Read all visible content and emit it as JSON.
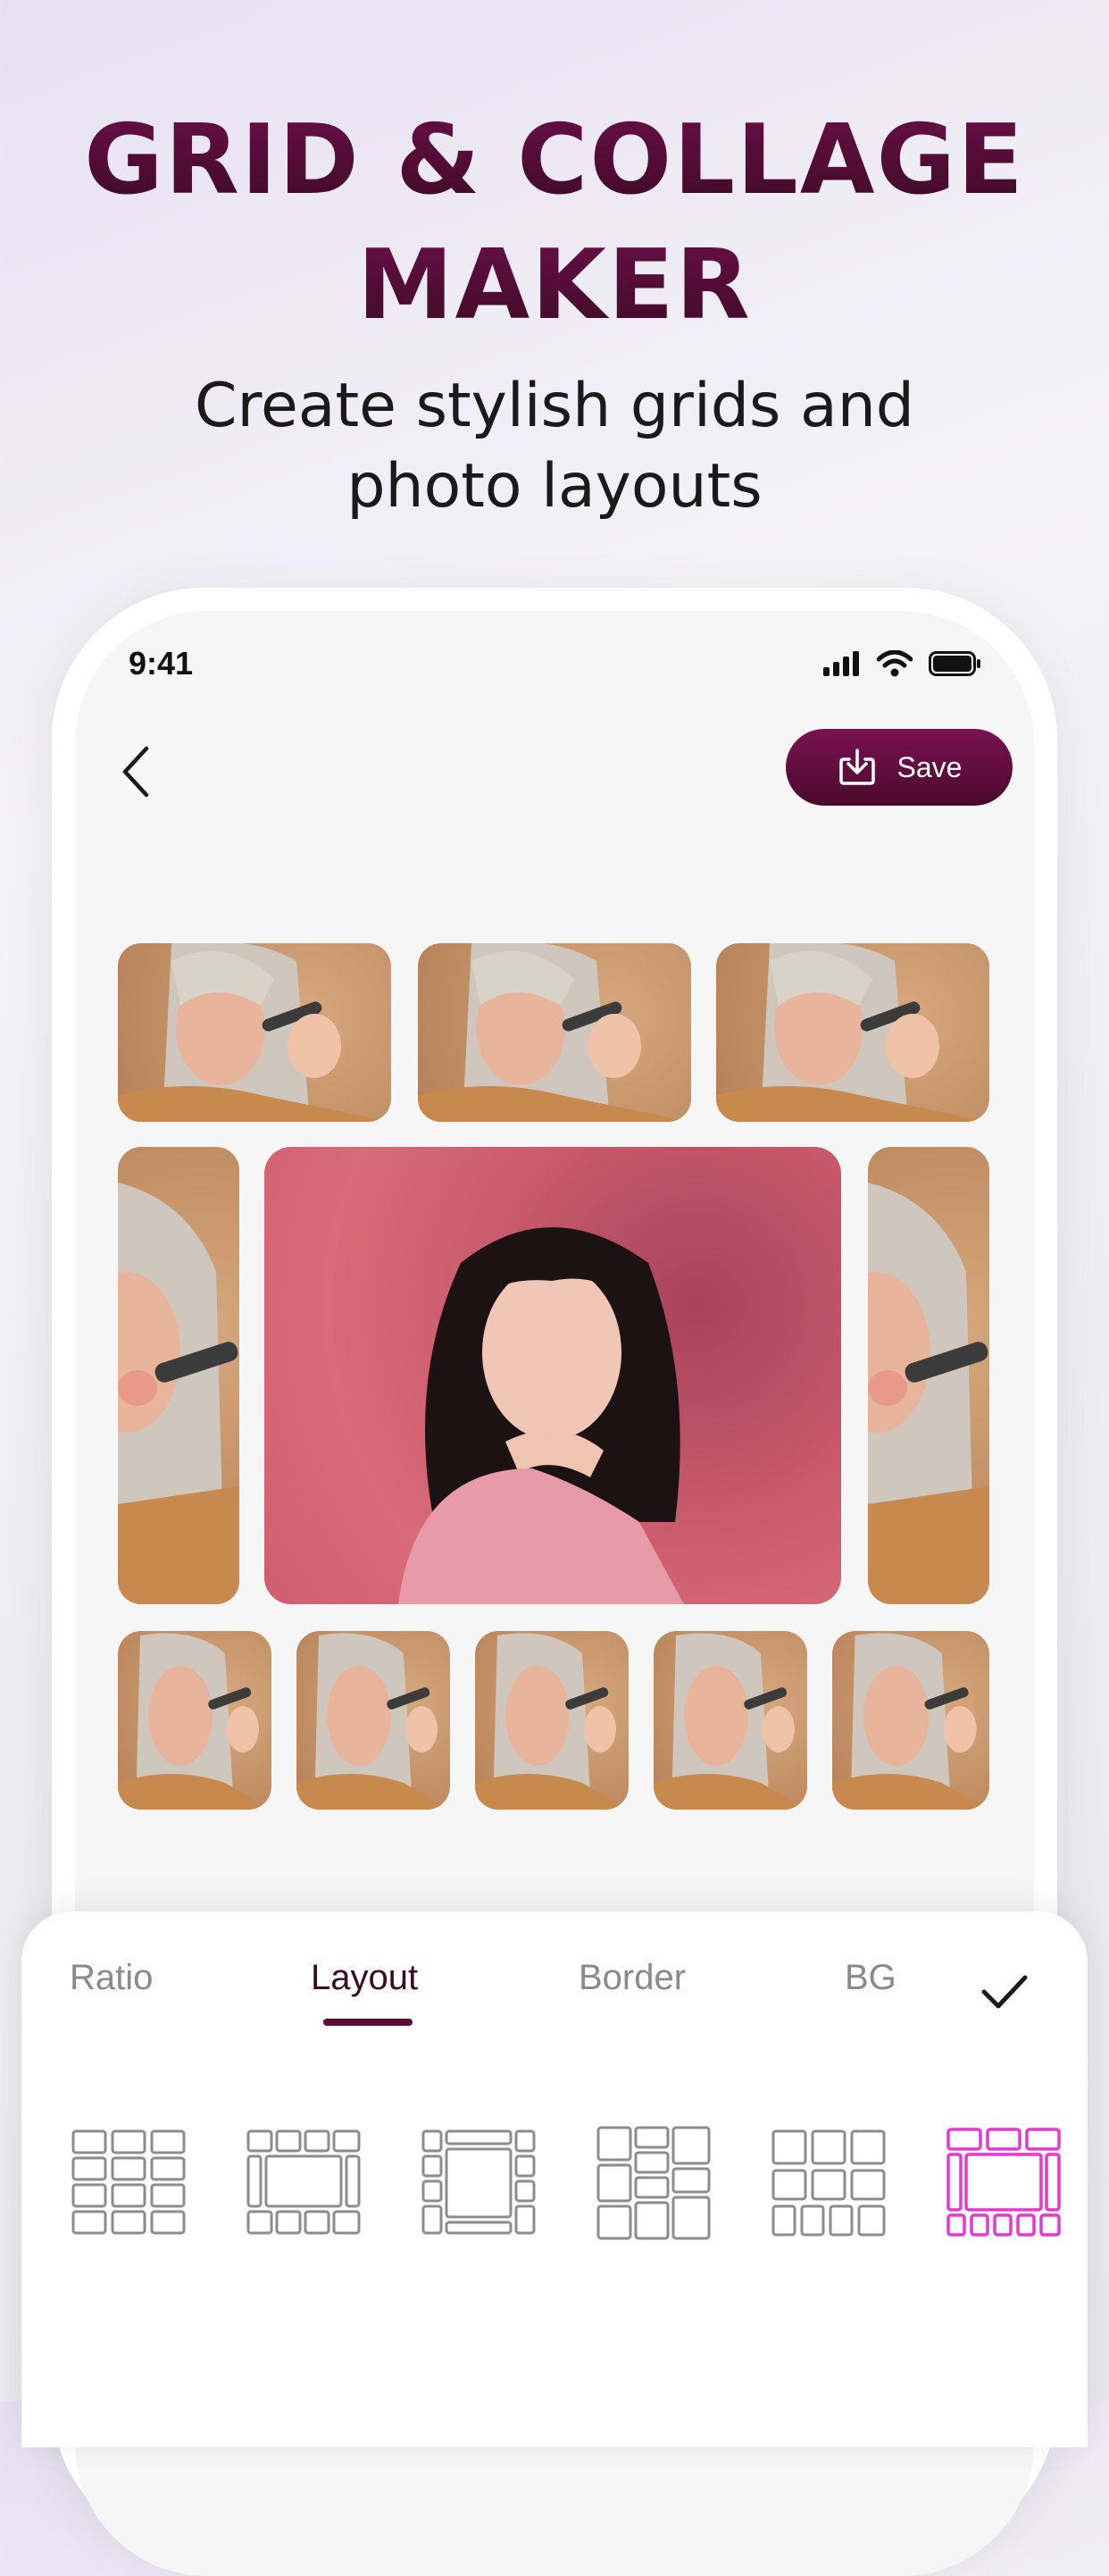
{
  "headline": {
    "line1": "GRID & COLLAGE",
    "line2": "MAKER"
  },
  "subtitle": {
    "line1": "Create stylish grids and",
    "line2": "photo layouts"
  },
  "status_bar": {
    "time": "9:41"
  },
  "toolbar": {
    "save_label": "Save"
  },
  "tabs": [
    {
      "label": "Ratio",
      "active": false
    },
    {
      "label": "Layout",
      "active": true
    },
    {
      "label": "Border",
      "active": false
    },
    {
      "label": "BG",
      "active": false
    }
  ],
  "layout_options": [
    {
      "name": "grid-3x4",
      "selected": false
    },
    {
      "name": "frame-banner",
      "selected": false
    },
    {
      "name": "center-column",
      "selected": false
    },
    {
      "name": "mosaic",
      "selected": false
    },
    {
      "name": "grid-3-3-4",
      "selected": false
    },
    {
      "name": "hero-frame",
      "selected": true
    }
  ],
  "colors": {
    "brand": "#5a0d35",
    "accent_selected": "#e23ad0",
    "tab_inactive": "#8a8a8a",
    "icon_outline": "#8c8c8c"
  },
  "icons": [
    "back-icon",
    "download-icon",
    "checkmark-icon",
    "signal-icon",
    "wifi-icon",
    "battery-icon"
  ]
}
